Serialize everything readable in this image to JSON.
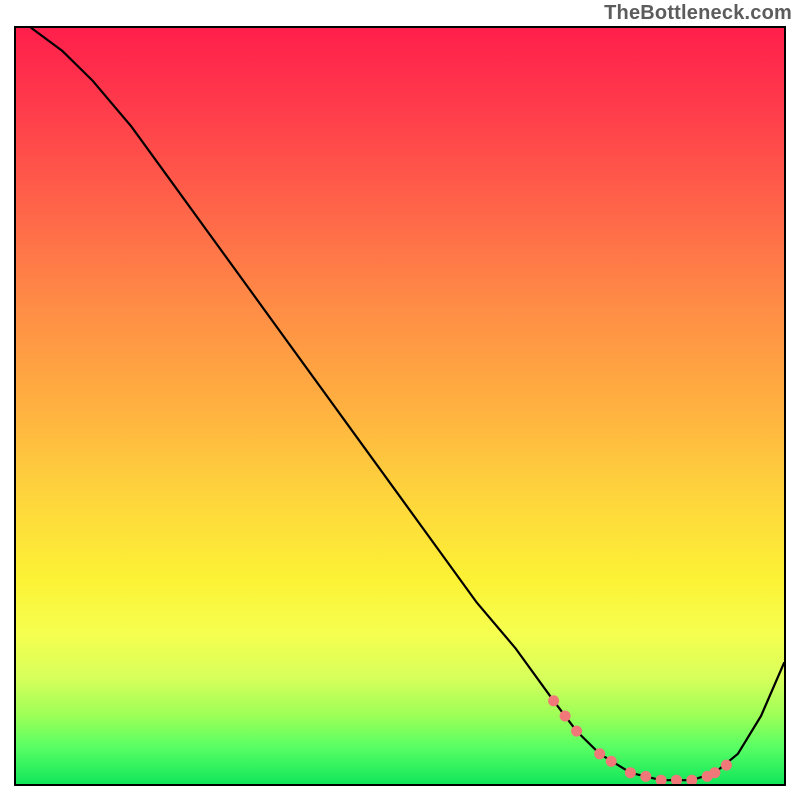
{
  "watermark": "TheBottleneck.com",
  "chart_data": {
    "type": "line",
    "title": "",
    "xlabel": "",
    "ylabel": "",
    "xlim": [
      0,
      100
    ],
    "ylim": [
      0,
      100
    ],
    "grid": false,
    "legend": false,
    "colors": {
      "curve": "#000000",
      "markers": "#f07878",
      "gradient_top": "#ff1f4b",
      "gradient_bottom": "#11e65a"
    },
    "series": [
      {
        "name": "bottleneck-curve",
        "x": [
          2,
          6,
          10,
          15,
          20,
          25,
          30,
          35,
          40,
          45,
          50,
          55,
          60,
          65,
          70,
          73,
          76,
          80,
          84,
          88,
          91,
          94,
          97,
          100
        ],
        "y": [
          100,
          97,
          93,
          87,
          80,
          73,
          66,
          59,
          52,
          45,
          38,
          31,
          24,
          18,
          11,
          7,
          4,
          1.5,
          0.5,
          0.5,
          1.5,
          4,
          9,
          16
        ]
      }
    ],
    "markers": {
      "name": "highlight-dots",
      "color": "#f07878",
      "points": [
        {
          "x": 70,
          "y": 11
        },
        {
          "x": 71.5,
          "y": 9
        },
        {
          "x": 73,
          "y": 7
        },
        {
          "x": 76,
          "y": 4
        },
        {
          "x": 77.5,
          "y": 3
        },
        {
          "x": 80,
          "y": 1.5
        },
        {
          "x": 82,
          "y": 1
        },
        {
          "x": 84,
          "y": 0.5
        },
        {
          "x": 86,
          "y": 0.5
        },
        {
          "x": 88,
          "y": 0.5
        },
        {
          "x": 90,
          "y": 1
        },
        {
          "x": 91,
          "y": 1.5
        },
        {
          "x": 92.5,
          "y": 2.5
        }
      ]
    }
  }
}
